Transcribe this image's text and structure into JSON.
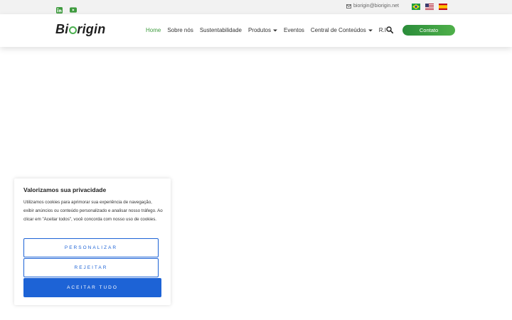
{
  "topbar": {
    "email": "biorigin@biorigin.net",
    "social": [
      "linkedin-icon",
      "youtube-icon"
    ],
    "flags": [
      "brazil-flag-icon",
      "usa-flag-icon",
      "spain-flag-icon"
    ]
  },
  "header": {
    "logo_before": "Bi",
    "logo_after": "rigin",
    "nav": [
      {
        "label": "Home",
        "active": true,
        "dropdown": false
      },
      {
        "label": "Sobre nós",
        "active": false,
        "dropdown": false
      },
      {
        "label": "Sustentabilidade",
        "active": false,
        "dropdown": false
      },
      {
        "label": "Produtos",
        "active": false,
        "dropdown": true
      },
      {
        "label": "Eventos",
        "active": false,
        "dropdown": false
      },
      {
        "label": "Central de Conteúdos",
        "active": false,
        "dropdown": true
      },
      {
        "label": "R.I",
        "active": false,
        "dropdown": false
      }
    ],
    "cta_label": "Contato"
  },
  "cookie": {
    "title": "Valorizamos sua privacidade",
    "text": "Utilizamos cookies para aprimorar sua experiência de navegação, exibir anúncios ou conteúdo personalizado e analisar nosso tráfego. Ao clicar em \"Aceitar todos\", você concorda com nosso uso de cookies.",
    "customize_label": "PERSONALIZAR",
    "reject_label": "REJEITAR",
    "accept_label": "ACEITAR TUDO"
  },
  "colors": {
    "accent_green": "#3e9b3e",
    "button_blue": "#1d63d6"
  }
}
